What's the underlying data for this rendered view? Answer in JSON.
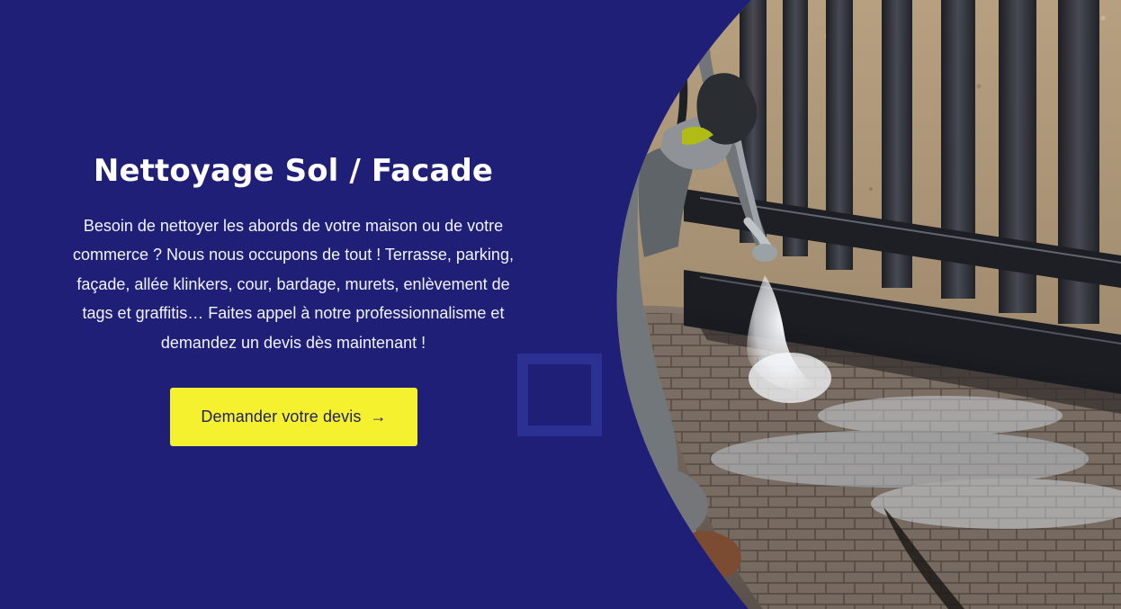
{
  "hero": {
    "title": "Nettoyage Sol / Facade",
    "description": "Besoin de nettoyer les abords de votre maison ou de votre commerce ? Nous nous occupons de tout ! Terrasse, parking, façade, allée klinkers, cour, bardage, murets, enlèvement de tags et graffitis… Faites appel à notre professionnalisme et demandez un devis dès maintenant !",
    "cta": {
      "label": "Demander votre devis",
      "icon": "arrow-right-icon",
      "icon_glyph": "→"
    },
    "colors": {
      "background": "#1f1f78",
      "accent": "#f5f12f"
    }
  }
}
